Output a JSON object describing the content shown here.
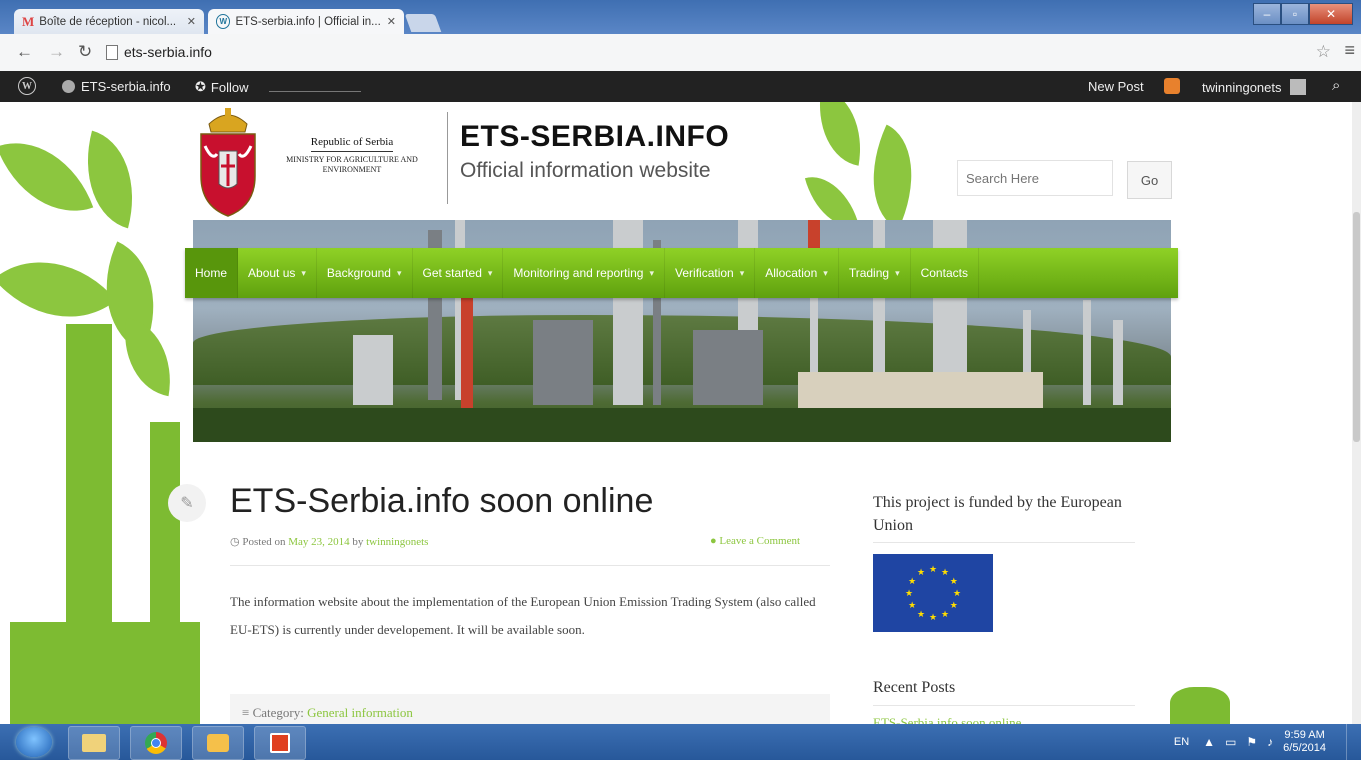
{
  "browser": {
    "tabs": [
      {
        "label": "Boîte de réception - nicol..."
      },
      {
        "label": "ETS-serbia.info | Official in..."
      }
    ],
    "address": "ets-serbia.info"
  },
  "adminbar": {
    "site": "ETS-serbia.info",
    "follow": "Follow",
    "new_post": "New Post",
    "user": "twinningonets"
  },
  "header": {
    "republic": "Republic of Serbia",
    "ministry": "MINISTRY FOR AGRICULTURE AND ENVIRONMENT",
    "title": "ETS-SERBIA.INFO",
    "tagline": "Official information website",
    "search_placeholder": "Search Here",
    "go_label": "Go"
  },
  "nav": [
    {
      "label": "Home"
    },
    {
      "label": "About us"
    },
    {
      "label": "Background"
    },
    {
      "label": "Get started"
    },
    {
      "label": "Monitoring and reporting"
    },
    {
      "label": "Verification"
    },
    {
      "label": "Allocation"
    },
    {
      "label": "Trading"
    },
    {
      "label": "Contacts"
    }
  ],
  "post": {
    "title": "ETS-Serbia.info soon online",
    "posted_on": "Posted on",
    "date": "May 23, 2014",
    "by": "by",
    "author": "twinningonets",
    "comment": "Leave a Comment",
    "excerpt": "The information website about the implementation of the European Union Emission Trading System (also called EU-ETS) is currently under developement. It will be available soon.",
    "category_label": "Category:",
    "category": "General information"
  },
  "sidebar": {
    "funded": "This project is funded by the European Union",
    "recent_title": "Recent Posts",
    "recent_items": [
      "ETS-Serbia.info soon online"
    ]
  },
  "taskbar": {
    "lang": "EN",
    "time": "9:59 AM",
    "date": "6/5/2014"
  },
  "colors": {
    "accent_green": "#8cc63f",
    "admin_bar": "#222222",
    "eu_blue": "#1f45a3"
  }
}
